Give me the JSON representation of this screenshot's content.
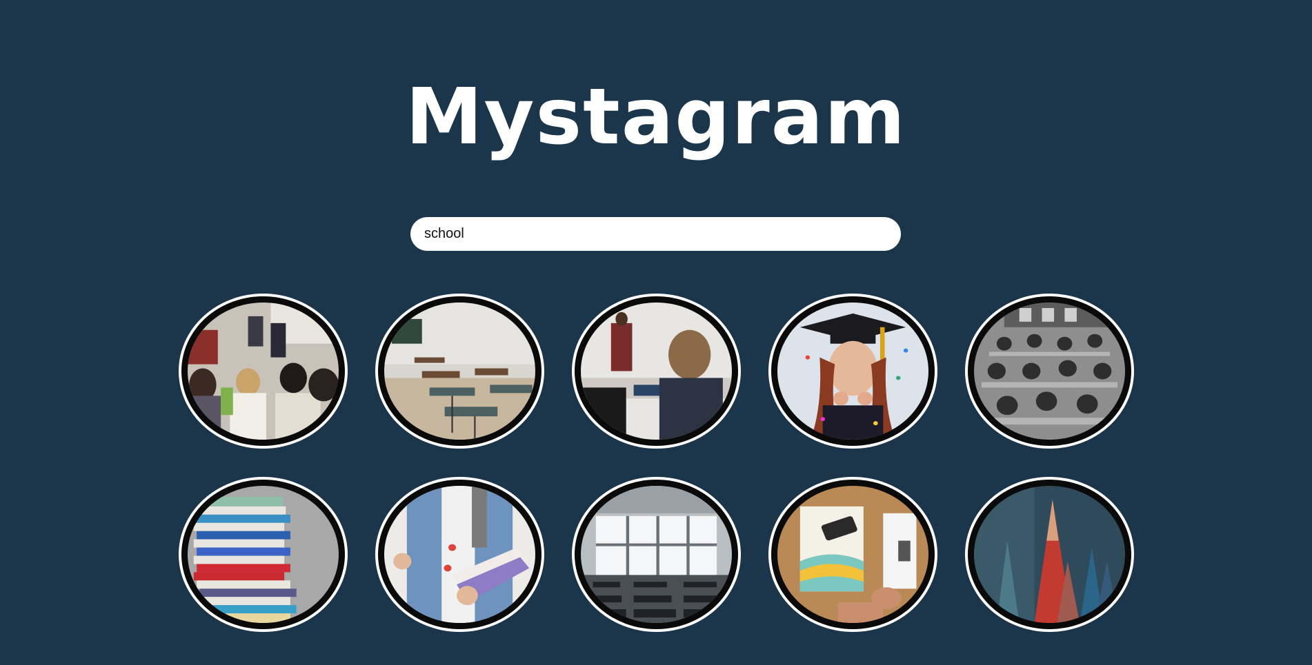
{
  "app": {
    "title": "Mystagram"
  },
  "search": {
    "value": "school",
    "placeholder": ""
  },
  "photos": [
    {
      "subject": "classroom-children-sitting"
    },
    {
      "subject": "empty-classroom-desks"
    },
    {
      "subject": "student-back-teacher"
    },
    {
      "subject": "graduate-confetti"
    },
    {
      "subject": "vintage-classroom-bw"
    },
    {
      "subject": "stack-of-books"
    },
    {
      "subject": "student-holding-books"
    },
    {
      "subject": "empty-lecture-room"
    },
    {
      "subject": "desk-book-phone"
    },
    {
      "subject": "colored-pencils"
    }
  ],
  "colors": {
    "background": "#1b354a",
    "title": "#ffffff",
    "search_bg": "#ffffff",
    "thumb_border_outer": "#ffffff",
    "thumb_border_inner": "#0a0a0a"
  }
}
